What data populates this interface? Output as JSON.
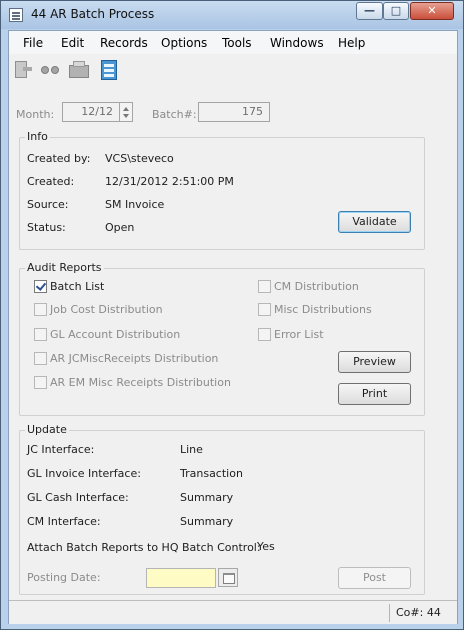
{
  "window": {
    "title": "44 AR Batch Process",
    "minimize_glyph": "—",
    "maximize_glyph": "□",
    "close_glyph": "✕"
  },
  "menu": [
    {
      "label": "File"
    },
    {
      "label": "Edit"
    },
    {
      "label": "Records"
    },
    {
      "label": "Options"
    },
    {
      "label": "Tools"
    },
    {
      "label": "Windows"
    },
    {
      "label": "Help"
    }
  ],
  "toolbar_icons": [
    "document-icon",
    "binoculars-icon",
    "printer-icon",
    "calculator-icon"
  ],
  "header": {
    "month_label": "Month:",
    "month_value": "12/12",
    "batch_label": "Batch#:",
    "batch_value": "175"
  },
  "info": {
    "title": "Info",
    "created_by_label": "Created by:",
    "created_by_value": "VCS\\steveco",
    "created_label": "Created:",
    "created_value": "12/31/2012 2:51:00 PM",
    "source_label": "Source:",
    "source_value": "SM Invoice",
    "status_label": "Status:",
    "status_value": "Open",
    "validate_label": "Validate"
  },
  "audit": {
    "title": "Audit Reports",
    "left_options": [
      {
        "label": "Batch List",
        "checked": true,
        "enabled": true
      },
      {
        "label": "Job Cost Distribution",
        "checked": false,
        "enabled": false
      },
      {
        "label": "GL Account Distribution",
        "checked": false,
        "enabled": false
      },
      {
        "label": "AR JCMiscReceipts Distribution",
        "checked": false,
        "enabled": false
      },
      {
        "label": "AR EM Misc Receipts Distribution",
        "checked": false,
        "enabled": false
      }
    ],
    "right_options": [
      {
        "label": "CM Distribution",
        "checked": false,
        "enabled": false
      },
      {
        "label": "Misc Distributions",
        "checked": false,
        "enabled": false
      },
      {
        "label": "Error List",
        "checked": false,
        "enabled": false
      }
    ],
    "preview_label": "Preview",
    "print_label": "Print"
  },
  "update": {
    "title": "Update",
    "rows": [
      {
        "label": "JC Interface:",
        "value": "Line"
      },
      {
        "label": "GL Invoice Interface:",
        "value": "Transaction"
      },
      {
        "label": "GL Cash Interface:",
        "value": "Summary"
      },
      {
        "label": "CM Interface:",
        "value": "Summary"
      }
    ],
    "attach_label": "Attach Batch Reports to HQ Batch Control:",
    "attach_value": "Yes",
    "posting_date_label": "Posting Date:",
    "posting_date_value": "",
    "post_label": "Post"
  },
  "status": {
    "company": "Co#: 44"
  }
}
